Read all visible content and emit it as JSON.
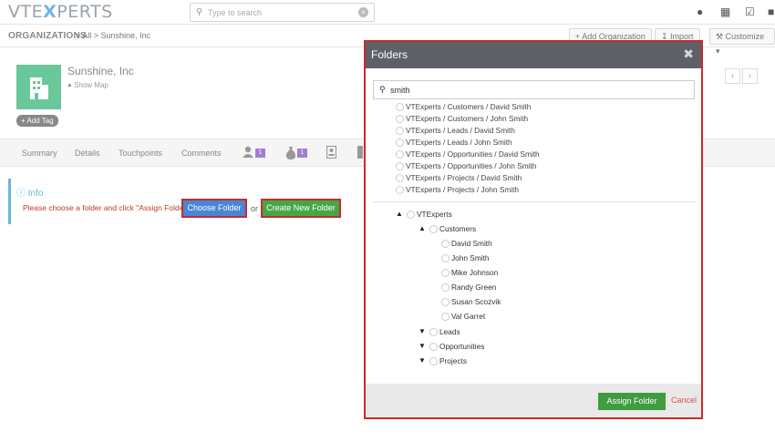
{
  "app": {
    "logo_pre": "VTE",
    "logo_x": "X",
    "logo_post": "PERTS",
    "search_placeholder": "Type to search"
  },
  "breadcrumb": {
    "module": "ORGANIZATIONS",
    "rest": "> All > Sunshine, Inc"
  },
  "header_buttons": {
    "add_org": "+ Add Organization",
    "import": "Import",
    "customize": "Customize"
  },
  "record": {
    "name": "Sunshine, Inc",
    "show_map": "Show Map",
    "add_tag": "Add Tag",
    "prev": "‹",
    "next": "›"
  },
  "tabs": {
    "summary": "Summary",
    "details": "Details",
    "touchpoints": "Touchpoints",
    "comments": "Comments",
    "badge1": "1",
    "badge2": "1"
  },
  "info": {
    "title": "Info",
    "message": "Please choose a folder and click \"Assign Folder\".",
    "choose_folder": "Choose Folder",
    "or": "or",
    "create_folder": "Create New Folder"
  },
  "modal": {
    "title": "Folders",
    "search_value": "smith",
    "results": [
      "VTExperts / Customers / David Smith",
      "VTExperts / Customers / John Smith",
      "VTExperts / Leads / David Smith",
      "VTExperts / Leads / John Smith",
      "VTExperts / Opportunities / David Smith",
      "VTExperts / Opportunities / John Smith",
      "VTExperts / Projects / David Smith",
      "VTExperts / Projects / John Smith"
    ],
    "tree": {
      "root": "VTExperts",
      "customers": "Customers",
      "customer_children": [
        "David Smith",
        "John Smith",
        "Mike Johnson",
        "Randy Green",
        "Susan Scozvik",
        "Val Garret"
      ],
      "leads": "Leads",
      "opportunities": "Opportunities",
      "projects": "Projects"
    },
    "assign": "Assign Folder",
    "cancel": "Cancel"
  }
}
